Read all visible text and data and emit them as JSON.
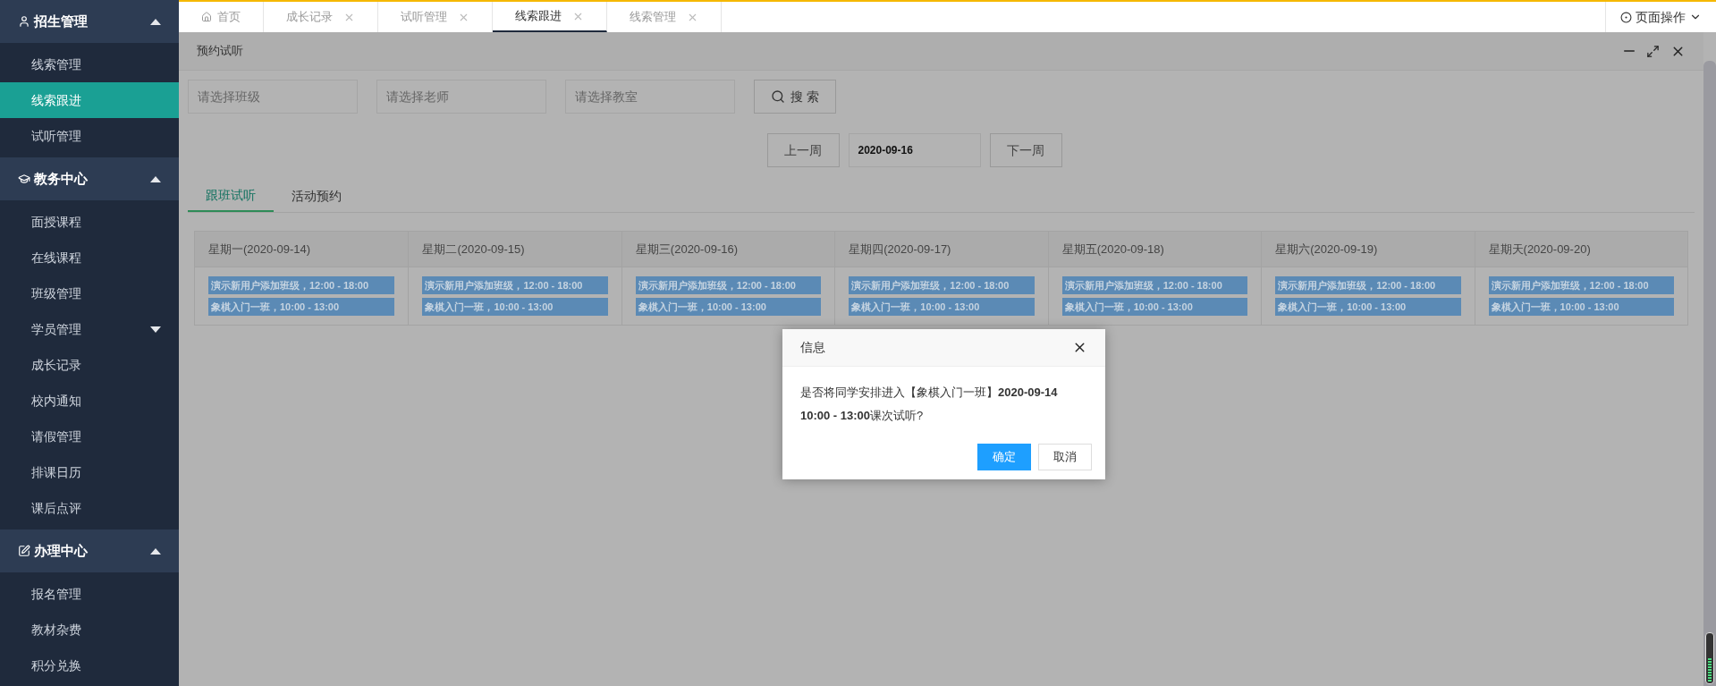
{
  "sidebar": {
    "sections": [
      {
        "title": "招生管理",
        "expanded": true,
        "items": [
          {
            "label": "线索管理",
            "selected": false,
            "kind": "link"
          },
          {
            "label": "线索跟进",
            "selected": true,
            "kind": "link"
          },
          {
            "label": "试听管理",
            "selected": false,
            "kind": "link"
          }
        ]
      },
      {
        "title": "教务中心",
        "expanded": true,
        "items": [
          {
            "label": "面授课程",
            "selected": false,
            "kind": "link"
          },
          {
            "label": "在线课程",
            "selected": false,
            "kind": "link"
          },
          {
            "label": "班级管理",
            "selected": false,
            "kind": "link"
          },
          {
            "label": "学员管理",
            "selected": false,
            "kind": "submenu"
          },
          {
            "label": "成长记录",
            "selected": false,
            "kind": "link"
          },
          {
            "label": "校内通知",
            "selected": false,
            "kind": "link"
          },
          {
            "label": "请假管理",
            "selected": false,
            "kind": "link"
          },
          {
            "label": "排课日历",
            "selected": false,
            "kind": "link"
          },
          {
            "label": "课后点评",
            "selected": false,
            "kind": "link"
          }
        ]
      },
      {
        "title": "办理中心",
        "expanded": true,
        "items": [
          {
            "label": "报名管理",
            "selected": false,
            "kind": "link"
          },
          {
            "label": "教材杂费",
            "selected": false,
            "kind": "link"
          },
          {
            "label": "积分兑换",
            "selected": false,
            "kind": "link"
          }
        ]
      }
    ]
  },
  "page_tabs": [
    {
      "label": "首页",
      "selected": false,
      "kind": "home"
    },
    {
      "label": "成长记录",
      "selected": false,
      "kind": "closable"
    },
    {
      "label": "试听管理",
      "selected": false,
      "kind": "closable"
    },
    {
      "label": "线索跟进",
      "selected": true,
      "kind": "closable"
    },
    {
      "label": "线索管理",
      "selected": false,
      "kind": "closable"
    }
  ],
  "page_actions": "页面操作",
  "panel": {
    "title": "预约试听",
    "filters": [
      {
        "placeholder": "请选择班级"
      },
      {
        "placeholder": "请选择老师"
      },
      {
        "placeholder": "请选择教室"
      }
    ],
    "search_button": "搜 索",
    "week_nav": {
      "prev": "上一周",
      "date": "2020-09-16",
      "next": "下一周"
    },
    "tabs": [
      {
        "label": "跟班试听",
        "selected": true
      },
      {
        "label": "活动预约",
        "selected": false
      }
    ],
    "schedule": [
      {
        "day": "星期一(2020-09-14)",
        "entries": [
          "演示新用户添加班级，12:00 - 18:00",
          "象棋入门一班，10:00 - 13:00"
        ]
      },
      {
        "day": "星期二(2020-09-15)",
        "entries": [
          "演示新用户添加班级，12:00 - 18:00",
          "象棋入门一班，10:00 - 13:00"
        ]
      },
      {
        "day": "星期三(2020-09-16)",
        "entries": [
          "演示新用户添加班级，12:00 - 18:00",
          "象棋入门一班，10:00 - 13:00"
        ]
      },
      {
        "day": "星期四(2020-09-17)",
        "entries": [
          "演示新用户添加班级，12:00 - 18:00",
          "象棋入门一班，10:00 - 13:00"
        ]
      },
      {
        "day": "星期五(2020-09-18)",
        "entries": [
          "演示新用户添加班级，12:00 - 18:00",
          "象棋入门一班，10:00 - 13:00"
        ]
      },
      {
        "day": "星期六(2020-09-19)",
        "entries": [
          "演示新用户添加班级，12:00 - 18:00",
          "象棋入门一班，10:00 - 13:00"
        ]
      },
      {
        "day": "星期天(2020-09-20)",
        "entries": [
          "演示新用户添加班级，12:00 - 18:00",
          "象棋入门一班，10:00 - 13:00"
        ]
      }
    ]
  },
  "dialog": {
    "title": "信息",
    "message": "是否将同学安排进入【象棋入门一班】**2020-09-14 10:00 - 13:00**课次试听?",
    "buttons": [
      {
        "label": "确定",
        "kind": "primary"
      },
      {
        "label": "取消",
        "kind": "secondary"
      }
    ]
  }
}
